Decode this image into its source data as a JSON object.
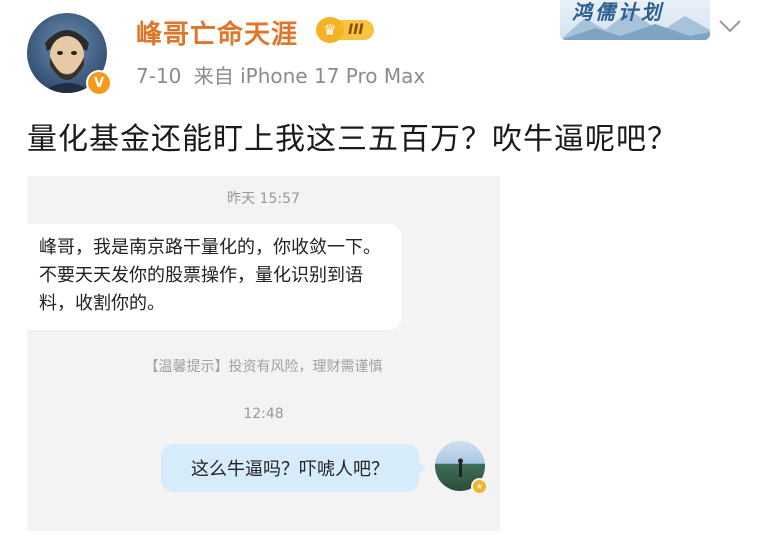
{
  "post": {
    "author": {
      "name": "峰哥亡命天涯",
      "vip_level": "III",
      "verified_symbol": "V",
      "avatar_icon": "bearded-man-avatar"
    },
    "date": "7-10",
    "source": "来自 iPhone 17 Pro Max",
    "banner_text": "鸿儒计划",
    "text": "量化基金还能盯上我这三五百万？吹牛逼呢吧？"
  },
  "chat_screenshot": {
    "time_1": "昨天 15:57",
    "incoming_message": "峰哥，我是南京路干量化的，你收敛一下。不要天天发你的股票操作，量化识别到语料，收割你的。",
    "notice": "【温馨提示】投资有风险，理财需谨慎",
    "time_2": "12:48",
    "outgoing_message": "这么牛逼吗？吓唬人吧？",
    "colors": {
      "outgoing_bubble": "#d6ecfb",
      "incoming_bubble": "#ffffff",
      "background": "#f3f3f3"
    }
  },
  "colors": {
    "username": "#e0762c",
    "verified": "#f59a1b",
    "vip": "#f4b226"
  }
}
